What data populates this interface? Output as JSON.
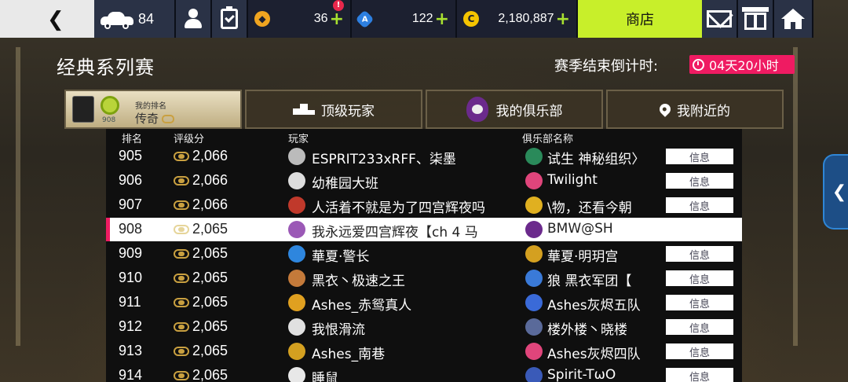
{
  "topbar": {
    "cars_count": "84",
    "gold_value": "36",
    "gold_alert": "!",
    "blue_value": "122",
    "credits_value": "2,180,887",
    "plus": "+",
    "shop_label": "商店"
  },
  "header": {
    "title": "经典系列赛",
    "season_label": "赛季结束倒计时:",
    "countdown": "04天20小时"
  },
  "tabs": {
    "my_rank_label": "我的排名",
    "my_rank_value": "传奇",
    "my_rank_number": "908",
    "top_players": "顶级玩家",
    "my_club": "我的俱乐部",
    "nearby": "我附近的"
  },
  "table": {
    "headers": {
      "rank": "排名",
      "score": "评级分",
      "player": "玩家",
      "club": "俱乐部名称"
    },
    "info_label": "信息",
    "rows": [
      {
        "rank": "905",
        "score": "2,066",
        "player": "ESPRIT233xRFF、柒墨",
        "club": "试生    神秘组织〉"
      },
      {
        "rank": "906",
        "score": "2,066",
        "player": "幼稚园大班",
        "club": "Twilight"
      },
      {
        "rank": "907",
        "score": "2,066",
        "player": "人活着不就是为了四宫辉夜吗",
        "club": "\\物，还看今朝"
      },
      {
        "rank": "908",
        "score": "2,065",
        "player": "我永远爱四宫辉夜【ch 4 马",
        "club": "BMW@SH"
      },
      {
        "rank": "909",
        "score": "2,065",
        "player": "華夏·警长",
        "club": "華夏·明玥宫"
      },
      {
        "rank": "910",
        "score": "2,065",
        "player": "黑衣丶极速之王",
        "club": "狼      黑衣军团【"
      },
      {
        "rank": "911",
        "score": "2,065",
        "player": "Ashes_赤鸳真人",
        "club": "Ashes灰烬五队"
      },
      {
        "rank": "912",
        "score": "2,065",
        "player": "我恨滑流",
        "club": "楼外楼丶晓楼"
      },
      {
        "rank": "913",
        "score": "2,065",
        "player": "Ashes_南巷",
        "club": "Ashes灰烬四队"
      },
      {
        "rank": "914",
        "score": "2,065",
        "player": "睡鼠",
        "club": "Spirit-TωO"
      }
    ]
  },
  "icons": {
    "back": "chevron-left-icon",
    "side_handle": "chevron-left-icon"
  },
  "colors": {
    "accent_shop": "#c8ef2a",
    "countdown_bg": "#ef1b62",
    "highlight_marker": "#ef1b62"
  }
}
